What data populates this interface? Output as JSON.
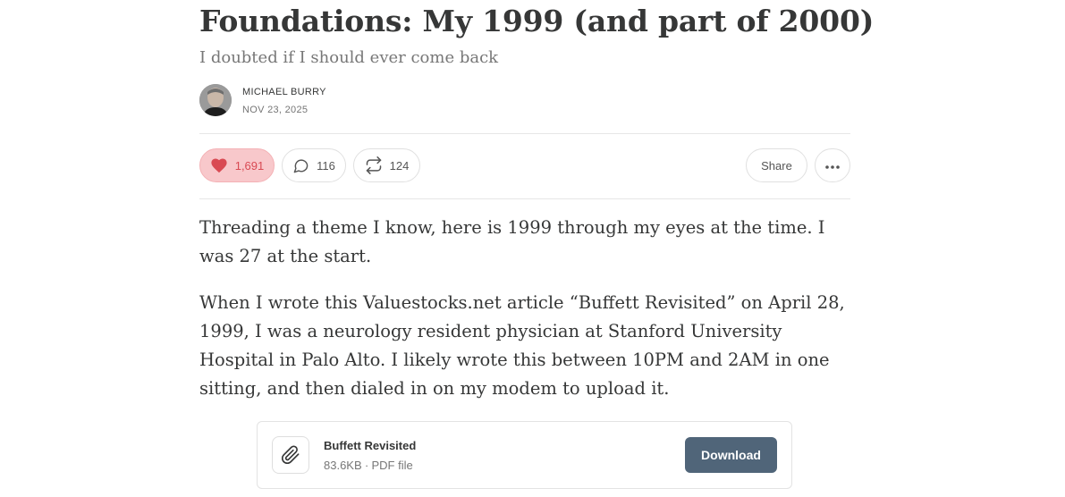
{
  "post": {
    "title": "Foundations: My 1999 (and part of 2000)",
    "subtitle": "I doubted if I should ever come back",
    "author": "MICHAEL BURRY",
    "date": "NOV 23, 2025"
  },
  "actions": {
    "likes": "1,691",
    "comments": "116",
    "restacks": "124",
    "share_label": "Share",
    "like_color": "#d94a53"
  },
  "body": {
    "paragraphs": [
      "Threading a theme I know, here is 1999 through my eyes at the time. I was 27 at the start.",
      "When I wrote this Valuestocks.net article “Buffett Revisited” on April 28, 1999, I was a neurology resident physician at Stanford University Hospital in Palo Alto. I likely wrote this between 10PM and 2AM in one sitting, and then dialed in on my modem to upload it."
    ]
  },
  "attachment": {
    "icon": "paperclip-icon",
    "name": "Buffett Revisited",
    "meta": "83.6KB ∙ PDF file",
    "download_label": "Download",
    "button_color": "#506579"
  }
}
